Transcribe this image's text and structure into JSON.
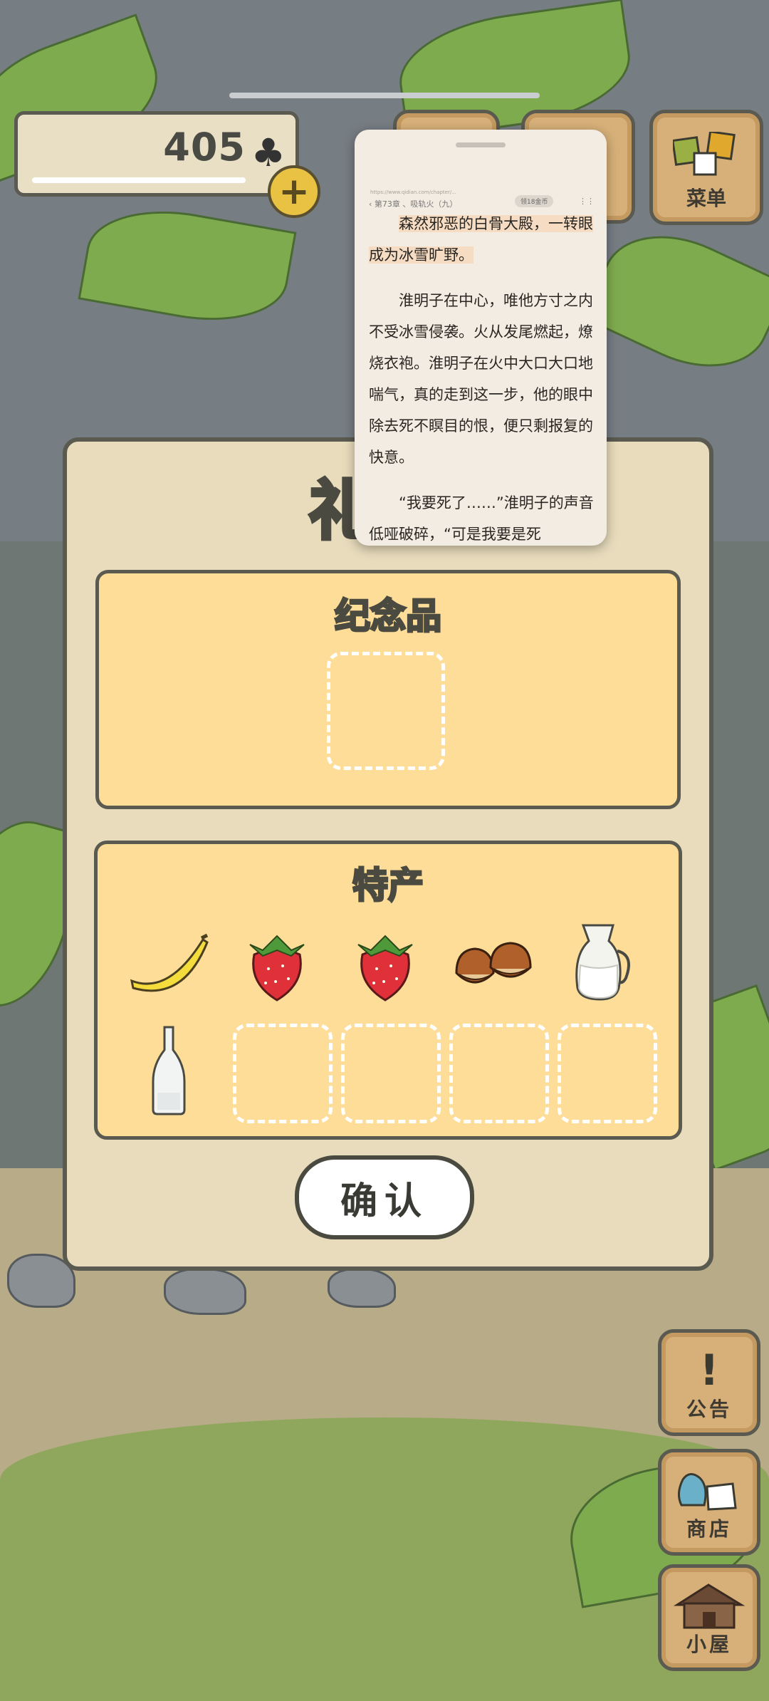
{
  "top_bar": {
    "clover_count": "405",
    "clover_icon": "clover-icon",
    "plus_label": "+",
    "menu_label": "菜单"
  },
  "dialog": {
    "title": "礼",
    "souvenir_panel": {
      "title": "纪念品",
      "slots_filled": 0,
      "slots_total": 1
    },
    "specialty_panel": {
      "title": "特产",
      "items": [
        {
          "name": "banana",
          "icon": "banana-icon"
        },
        {
          "name": "strawberry",
          "icon": "strawberry-icon"
        },
        {
          "name": "strawberry",
          "icon": "strawberry-icon"
        },
        {
          "name": "chestnuts",
          "icon": "chestnut-icon"
        },
        {
          "name": "milk-jug",
          "icon": "milk-jug-icon"
        },
        {
          "name": "glass-bottle",
          "icon": "bottle-icon"
        }
      ],
      "empty_slots": 4
    },
    "confirm_label": "确认"
  },
  "side_buttons": {
    "notice_label": "公告",
    "shop_label": "商店",
    "house_label": "小屋"
  },
  "reader_overlay": {
    "url": "https://www.qidian.com/chapter/...",
    "chapter": "‹ 第73章 、吸轨火（九）",
    "coin_badge": "领18金币",
    "para1": "森然邪恶的白骨大殿，一转眼成为冰雪旷野。",
    "para2": "淮明子在中心，唯他方寸之内不受冰雪侵袭。火从发尾燃起，燎烧衣袍。淮明子在火中大口大口地喘气，真的走到这一步，他的眼中除去死不瞑目的恨，便只剩报复的快意。",
    "para3": "“我要死了……”淮明子的声音低哑破碎，“可是我要是死"
  },
  "colors": {
    "panel_fill": "#fedd98",
    "dialog_fill": "#e8dcbc",
    "outline": "#5a5a50",
    "wood_button": "#d7b079"
  }
}
